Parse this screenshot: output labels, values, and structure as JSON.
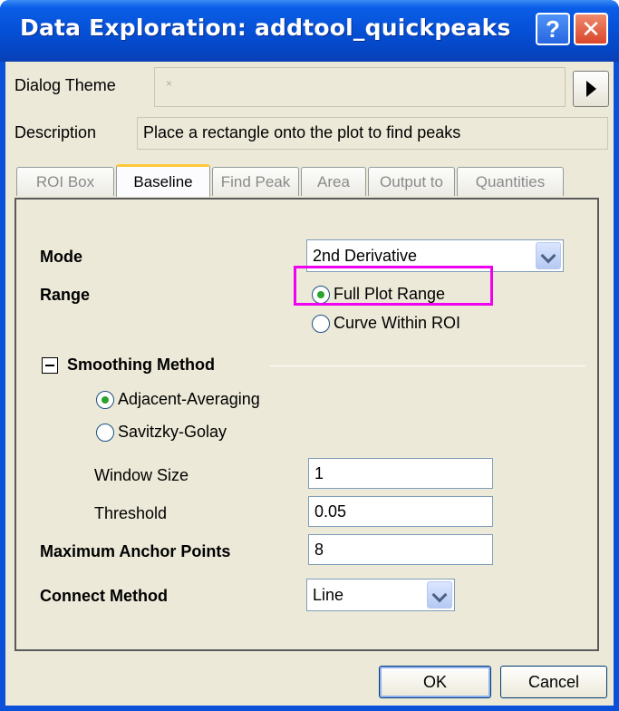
{
  "window": {
    "title": "Data Exploration: addtool_quickpeaks",
    "help_glyph": "?",
    "close_glyph": "✕"
  },
  "theme": {
    "label": "Dialog Theme",
    "value": "×"
  },
  "description": {
    "label": "Description",
    "value": "Place a rectangle onto the plot to find peaks"
  },
  "tabs": [
    {
      "label": "ROI Box",
      "active": false
    },
    {
      "label": "Baseline",
      "active": true
    },
    {
      "label": "Find Peak",
      "active": false
    },
    {
      "label": "Area",
      "active": false
    },
    {
      "label": "Output to",
      "active": false
    },
    {
      "label": "Quantities",
      "active": false
    }
  ],
  "mode": {
    "label": "Mode",
    "value": "2nd Derivative"
  },
  "range": {
    "label": "Range",
    "options": [
      {
        "label": "Full Plot Range",
        "selected": true
      },
      {
        "label": "Curve Within ROI",
        "selected": false
      }
    ]
  },
  "smoothing": {
    "title": "Smoothing Method",
    "options": [
      {
        "label": "Adjacent-Averaging",
        "selected": true
      },
      {
        "label": "Savitzky-Golay",
        "selected": false
      }
    ],
    "window_size": {
      "label": "Window Size",
      "value": "1"
    },
    "threshold": {
      "label": "Threshold",
      "value": "0.05"
    }
  },
  "anchor": {
    "label": "Maximum Anchor Points",
    "value": "8"
  },
  "connect": {
    "label": "Connect Method",
    "value": "Line"
  },
  "buttons": {
    "ok": "OK",
    "cancel": "Cancel"
  },
  "colors": {
    "title_bar": "#0550d6",
    "highlight": "#f000f0",
    "tab_active_accent": "#ffc83c"
  }
}
